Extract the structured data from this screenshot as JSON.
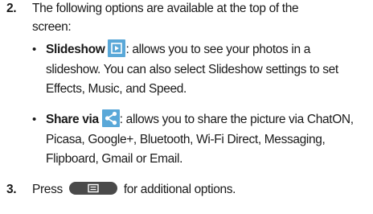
{
  "step2": {
    "number": "2.",
    "intro_line1": "The following options are available at the top of the",
    "intro_line2": "screen:"
  },
  "bullets": [
    {
      "term": "Slideshow",
      "icon": "slideshow-icon",
      "text_a": ": allows you to see your photos in a",
      "text_b": "slideshow. You can also select Slideshow settings to set",
      "text_c": "Effects, Music, and Speed."
    },
    {
      "term": "Share via",
      "icon": "share-icon",
      "text_a": ": allows you to share the picture via ChatON,",
      "text_b": "Picasa, Google+, Bluetooth, Wi-Fi Direct, Messaging,",
      "text_c": "Flipboard, Gmail or Email."
    }
  ],
  "step3": {
    "number": "3.",
    "text_before": "Press",
    "icon": "menu-key-icon",
    "text_after": "for additional options."
  },
  "bullet_glyph": "•",
  "colors": {
    "icon_blue": "#5aa8d8",
    "menu_key": "#4a4a4a"
  }
}
